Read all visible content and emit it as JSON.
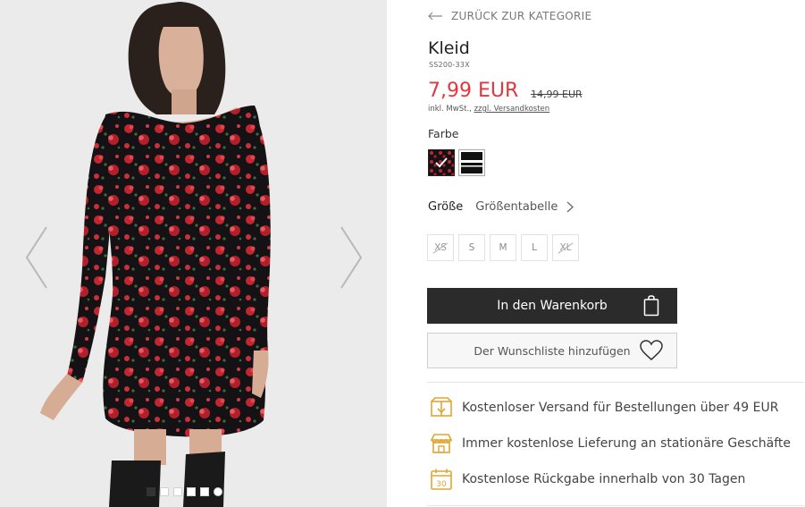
{
  "nav": {
    "back_label": "ZURÜCK ZUR KATEGORIE"
  },
  "product": {
    "title": "Kleid",
    "sku": "SS200-33X",
    "price": "7,99 EUR",
    "old_price": "14,99 EUR",
    "tax_prefix": "inkl. MwSt.,",
    "shipping_link": "zzgl. Versandkosten"
  },
  "color": {
    "label": "Farbe",
    "options": [
      {
        "name": "floral-black",
        "selected": true
      },
      {
        "name": "black-white-stripe",
        "selected": false
      }
    ]
  },
  "size": {
    "label": "Größe",
    "table_link": "Größentabelle",
    "options": [
      {
        "label": "XS",
        "available": false
      },
      {
        "label": "S",
        "available": true
      },
      {
        "label": "M",
        "available": true
      },
      {
        "label": "L",
        "available": true
      },
      {
        "label": "XL",
        "available": false
      }
    ]
  },
  "actions": {
    "cart_label": "In den Warenkorb",
    "wishlist_label": "Der Wunschliste hinzufügen"
  },
  "benefits": [
    {
      "icon": "truck-box-icon",
      "text": "Kostenloser Versand für Bestellungen über 49 EUR"
    },
    {
      "icon": "store-icon",
      "text": "Immer kostenlose Lieferung an stationäre Geschäfte"
    },
    {
      "icon": "calendar-30-icon",
      "text": "Kostenlose Rückgabe innerhalb von 30 Tagen"
    }
  ],
  "gallery": {
    "image_count": 6,
    "active_index": 0
  },
  "colors": {
    "accent_price": "#e2383d",
    "icon_gold": "#e0a632",
    "button_dark": "#2b2b2b"
  }
}
